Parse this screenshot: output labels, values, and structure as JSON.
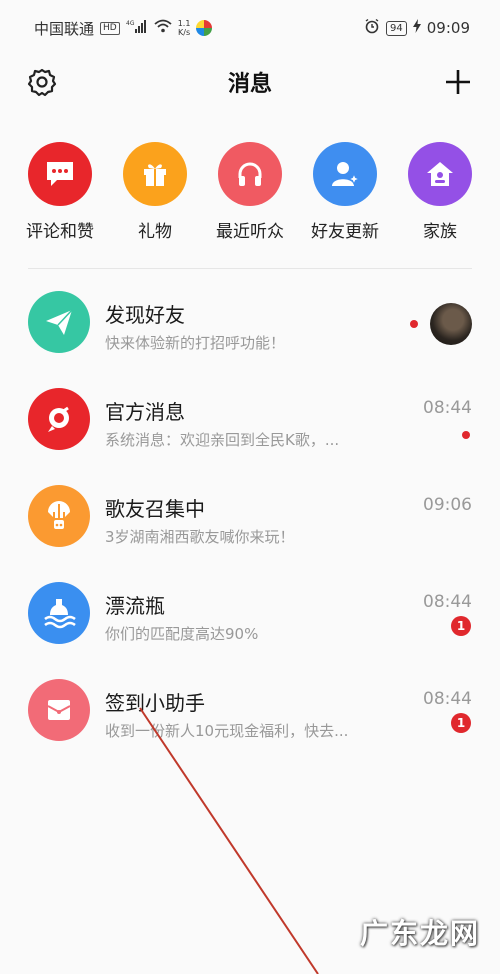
{
  "status_bar": {
    "carrier": "中国联通",
    "hd_tag": "HD",
    "signal_label": "4G",
    "speed": "1.1",
    "speed_unit": "K/s",
    "battery": "94",
    "time": "09:09"
  },
  "header": {
    "title": "消息",
    "left_icon": "gear-icon",
    "right_icon": "plus-icon"
  },
  "quick_actions": [
    {
      "label": "评论和赞",
      "icon": "comment-icon",
      "color": "#e8262b"
    },
    {
      "label": "礼物",
      "icon": "gift-icon",
      "color": "#fba21c"
    },
    {
      "label": "最近听众",
      "icon": "headphones-icon",
      "color": "#f05a62"
    },
    {
      "label": "好友更新",
      "icon": "friend-update-icon",
      "color": "#3f8ef0"
    },
    {
      "label": "家族",
      "icon": "home-icon",
      "color": "#9450e6"
    }
  ],
  "messages": [
    {
      "title": "发现好友",
      "subtitle": "快来体验新的打招呼功能！",
      "time": "",
      "icon": "paper-plane-icon",
      "color": "#36c7a3",
      "unread_dot": true,
      "badge": ""
    },
    {
      "title": "官方消息",
      "subtitle": "系统消息：欢迎亲回到全民K歌，...",
      "time": "08:44",
      "icon": "official-k-icon",
      "color": "#e8262b",
      "unread_dot": true,
      "badge": ""
    },
    {
      "title": "歌友召集中",
      "subtitle": "3岁湖南湘西歌友喊你来玩！",
      "time": "09:06",
      "icon": "balloon-icon",
      "color": "#fb9a31",
      "unread_dot": false,
      "badge": ""
    },
    {
      "title": "漂流瓶",
      "subtitle": "你们的匹配度高达90%",
      "time": "08:44",
      "icon": "bottle-icon",
      "color": "#3a8ff0",
      "unread_dot": false,
      "badge": "1"
    },
    {
      "title": "签到小助手",
      "subtitle": "收到一份新人10元现金福利，快去...",
      "time": "08:44",
      "icon": "checkin-envelope-icon",
      "color": "#f26b77",
      "unread_dot": false,
      "badge": "1"
    }
  ],
  "watermark": "广东龙网",
  "colors": {
    "unread": "#e0282d",
    "annotation": "#c0392b"
  }
}
